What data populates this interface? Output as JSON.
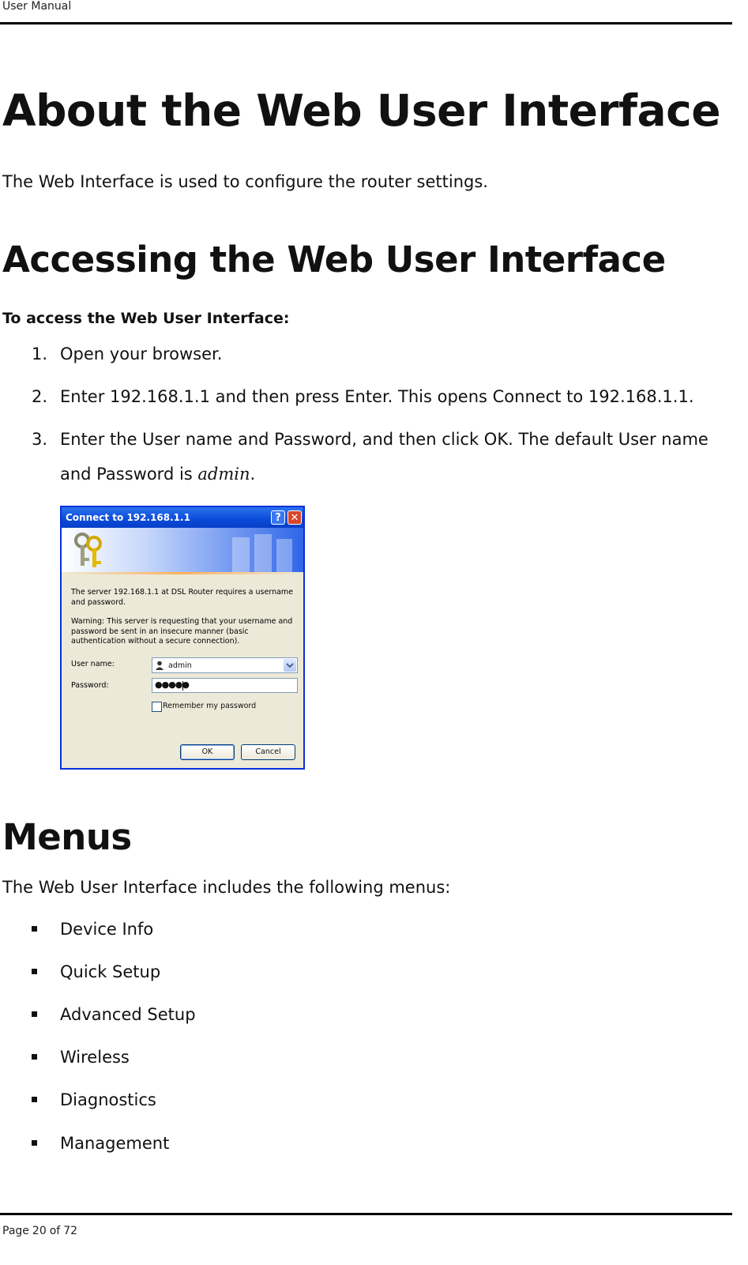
{
  "header": {
    "text": "User Manual"
  },
  "sections": {
    "about": {
      "title": "About the Web User Interface",
      "text": "The Web Interface is used to configure the router settings."
    },
    "accessing": {
      "title": "Accessing the Web User Interface",
      "subtitle": "To access the Web User Interface:",
      "steps": [
        {
          "num": "1.",
          "text": "Open your browser."
        },
        {
          "num": "2.",
          "text": "Enter 192.168.1.1 and then press Enter. This opens Connect to 192.168.1.1."
        },
        {
          "num": "3.",
          "text_before": "Enter the User name and Password, and then click OK. The default User name and Password is ",
          "emph": "admin",
          "text_after": "."
        }
      ]
    },
    "menus": {
      "title": "Menus",
      "text": "The Web User Interface includes the following menus:",
      "items": [
        "Device Info",
        "Quick Setup",
        "Advanced Setup",
        "Wireless",
        "Diagnostics",
        "Management"
      ]
    }
  },
  "dialog": {
    "title": "Connect to 192.168.1.1",
    "help_glyph": "?",
    "close_glyph": "✕",
    "message1": "The server 192.168.1.1 at DSL Router requires a username and password.",
    "message2": "Warning: This server is requesting that your username and password be sent in an insecure manner (basic authentication without a secure connection).",
    "username_label": "User name:",
    "username_value": "admin",
    "password_label": "Password:",
    "password_value": "●●●●●",
    "remember_label": "Remember my password",
    "ok_label": "OK",
    "cancel_label": "Cancel",
    "accent_color": "#0831d9"
  },
  "footer": {
    "page_label": "Page",
    "page_number": "20",
    "of_label": "of",
    "total_pages": "72"
  }
}
